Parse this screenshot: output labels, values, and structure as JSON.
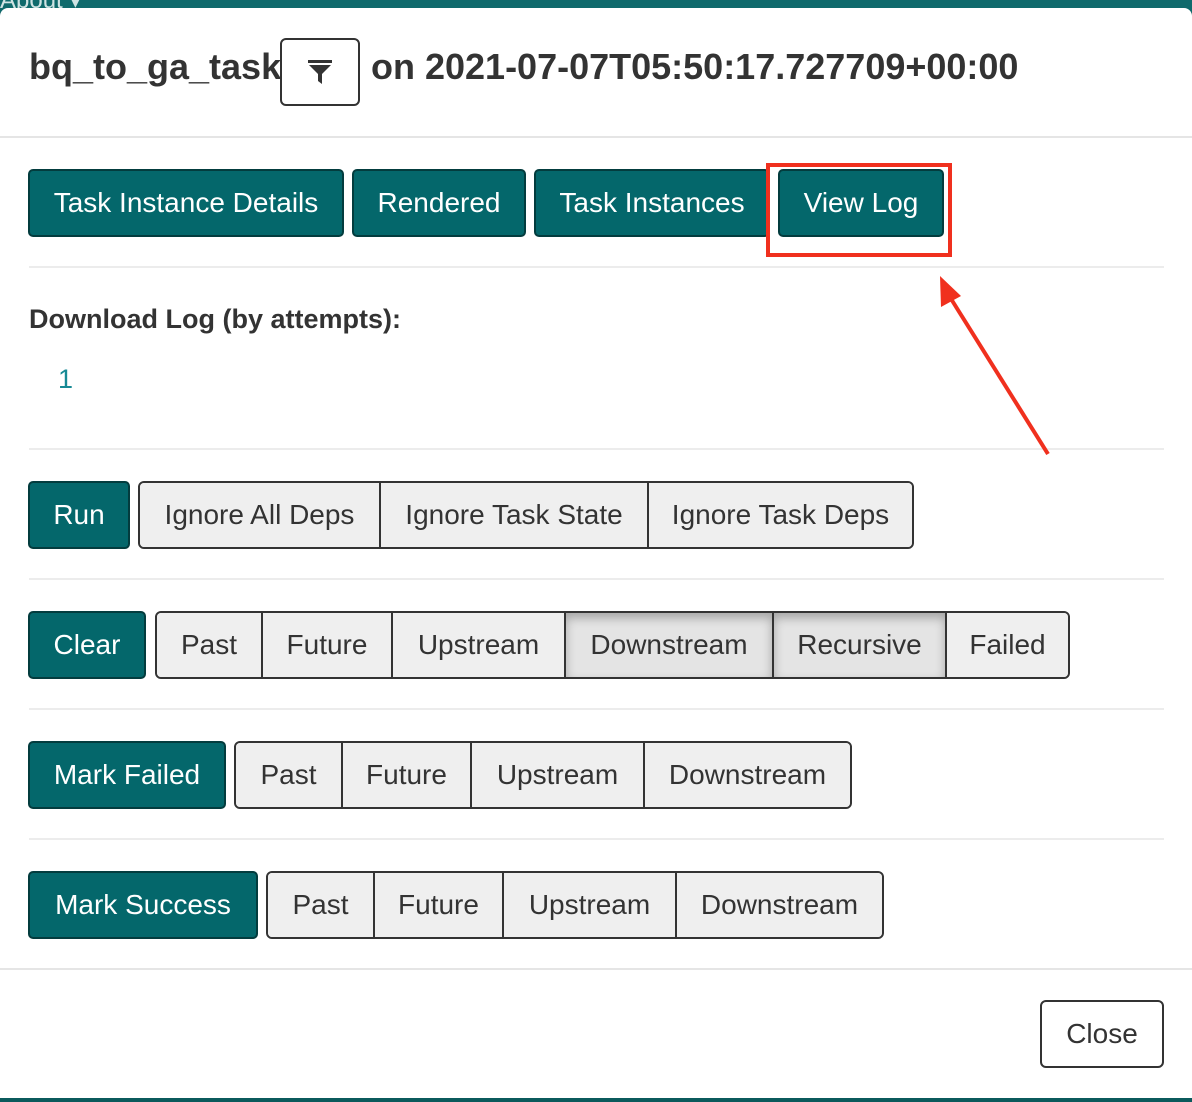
{
  "backdrop": {
    "menu_label": "About ▾"
  },
  "header": {
    "task_id": "bq_to_ga_task",
    "date_text": "on 2021-07-07T05:50:17.727709+00:00",
    "filter_icon": "filter-icon"
  },
  "nav_buttons": {
    "task_instance_details": "Task Instance Details",
    "rendered": "Rendered",
    "task_instances": "Task Instances",
    "view_log": "View Log"
  },
  "download": {
    "label": "Download Log (by attempts):",
    "attempts": [
      "1"
    ]
  },
  "run_row": {
    "action": "Run",
    "options": [
      "Ignore All Deps",
      "Ignore Task State",
      "Ignore Task Deps"
    ]
  },
  "clear_row": {
    "action": "Clear",
    "options": [
      "Past",
      "Future",
      "Upstream",
      "Downstream",
      "Recursive",
      "Failed"
    ],
    "active": [
      "Downstream",
      "Recursive"
    ]
  },
  "mark_failed_row": {
    "action": "Mark Failed",
    "options": [
      "Past",
      "Future",
      "Upstream",
      "Downstream"
    ]
  },
  "mark_success_row": {
    "action": "Mark Success",
    "options": [
      "Past",
      "Future",
      "Upstream",
      "Downstream"
    ]
  },
  "footer": {
    "close_label": "Close"
  },
  "colors": {
    "primary": "#04676b",
    "annotation": "#f0301e",
    "link": "#178a95"
  }
}
